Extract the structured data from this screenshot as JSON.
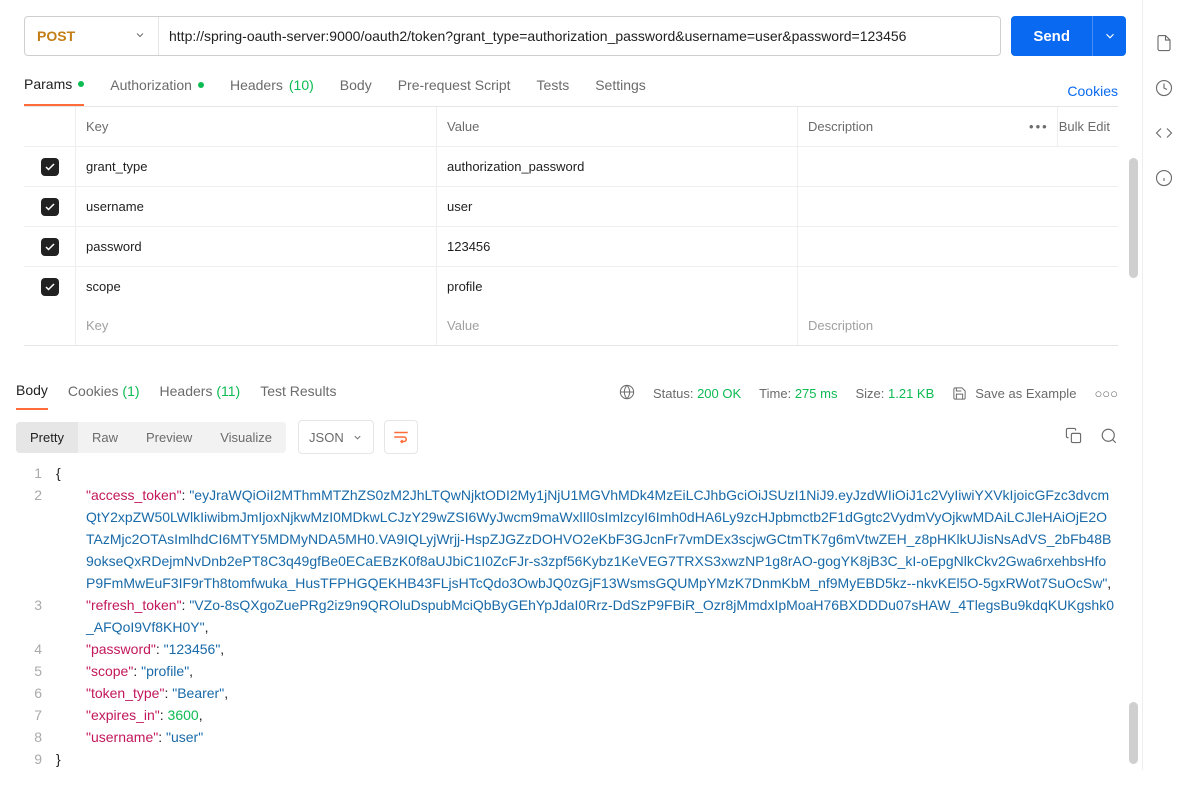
{
  "request": {
    "method": "POST",
    "url": "http://spring-oauth-server:9000/oauth2/token?grant_type=authorization_password&username=user&password=123456",
    "send_label": "Send"
  },
  "req_tabs": {
    "params": "Params",
    "auth": "Authorization",
    "headers": "Headers",
    "headers_count": "(10)",
    "body": "Body",
    "prereq": "Pre-request Script",
    "tests": "Tests",
    "settings": "Settings",
    "cookies": "Cookies"
  },
  "params_columns": {
    "key": "Key",
    "value": "Value",
    "desc": "Description"
  },
  "actions": {
    "more": "•••",
    "bulk": "Bulk Edit"
  },
  "params_rows": [
    {
      "key": "grant_type",
      "value": "authorization_password",
      "desc": ""
    },
    {
      "key": "username",
      "value": "user",
      "desc": ""
    },
    {
      "key": "password",
      "value": "123456",
      "desc": ""
    },
    {
      "key": "scope",
      "value": "profile",
      "desc": ""
    }
  ],
  "new_row_placeholders": {
    "key": "Key",
    "value": "Value",
    "desc": "Description"
  },
  "resp_tabs": {
    "body": "Body",
    "cookies": "Cookies",
    "cookies_count": "(1)",
    "headers": "Headers",
    "headers_count": "(11)",
    "tests": "Test Results"
  },
  "status": {
    "status_label": "Status:",
    "status_value": "200 OK",
    "time_label": "Time:",
    "time_value": "275 ms",
    "size_label": "Size:",
    "size_value": "1.21 KB",
    "save": "Save as Example"
  },
  "view_modes": {
    "pretty": "Pretty",
    "raw": "Raw",
    "preview": "Preview",
    "visualize": "Visualize",
    "json": "JSON"
  },
  "response_json": {
    "access_token": "eyJraWQiOiI2MThmMTZhZS0zM2JhLTQwNjktODI2My1jNjU1MGVhMDk4MzEiLCJhbGciOiJSUzI1NiJ9.eyJzdWIiOiJ1c2VyIiwiYXVkIjoicGFzc3dvcmQtY2xpZW50LWlkIiwibmJmIjoxNjkwMzI0MDkwLCJzY29wZSI6WyJwcm9maWxlIl0sImlzcyI6Imh0dHA6Ly9zcHJpbmctb2F1dGgtc2VydmVyOjkwMDAiLCJleHAiOjE2OTAzMjc2OTAsImlhdCI6MTY5MDMyNDA5MH0.VA9IQLyjWrjj-HspZJGZzDOHVO2eKbF3GJcnFr7vmDEx3scjwGCtmTK7g6mVtwZEH_z8pHKlkUJisNsAdVS_2bFb48B9okseQxRDejmNvDnb2ePT8C3q49gfBe0ECaEBzK0f8aUJbiC1I0ZcFJr-s3zpf56Kybz1KeVEG7TRXS3xwzNP1g8rAO-gogYK8jB3C_kI-oEpgNlkCkv2Gwa6rxehbsHfoP9FmMwEuF3IF9rTh8tomfwuka_HusTFPHGQEKHB43FLjsHTcQdo3OwbJQ0zGjF13WsmsGQUMpYMzK7DnmKbM_nf9MyEBD5kz--nkvKEl5O-5gxRWot7SuOcSw",
    "refresh_token": "VZo-8sQXgoZuePRg2iz9n9QROluDspubMciQbByGEhYpJdaI0Rrz-DdSzP9FBiR_Ozr8jMmdxIpMoaH76BXDDDu07sHAW_4TlegsBu9kdqKUKgshk0_AFQoI9Vf8KH0Y",
    "password": "123456",
    "scope": "profile",
    "token_type": "Bearer",
    "expires_in": 3600,
    "username": "user"
  }
}
